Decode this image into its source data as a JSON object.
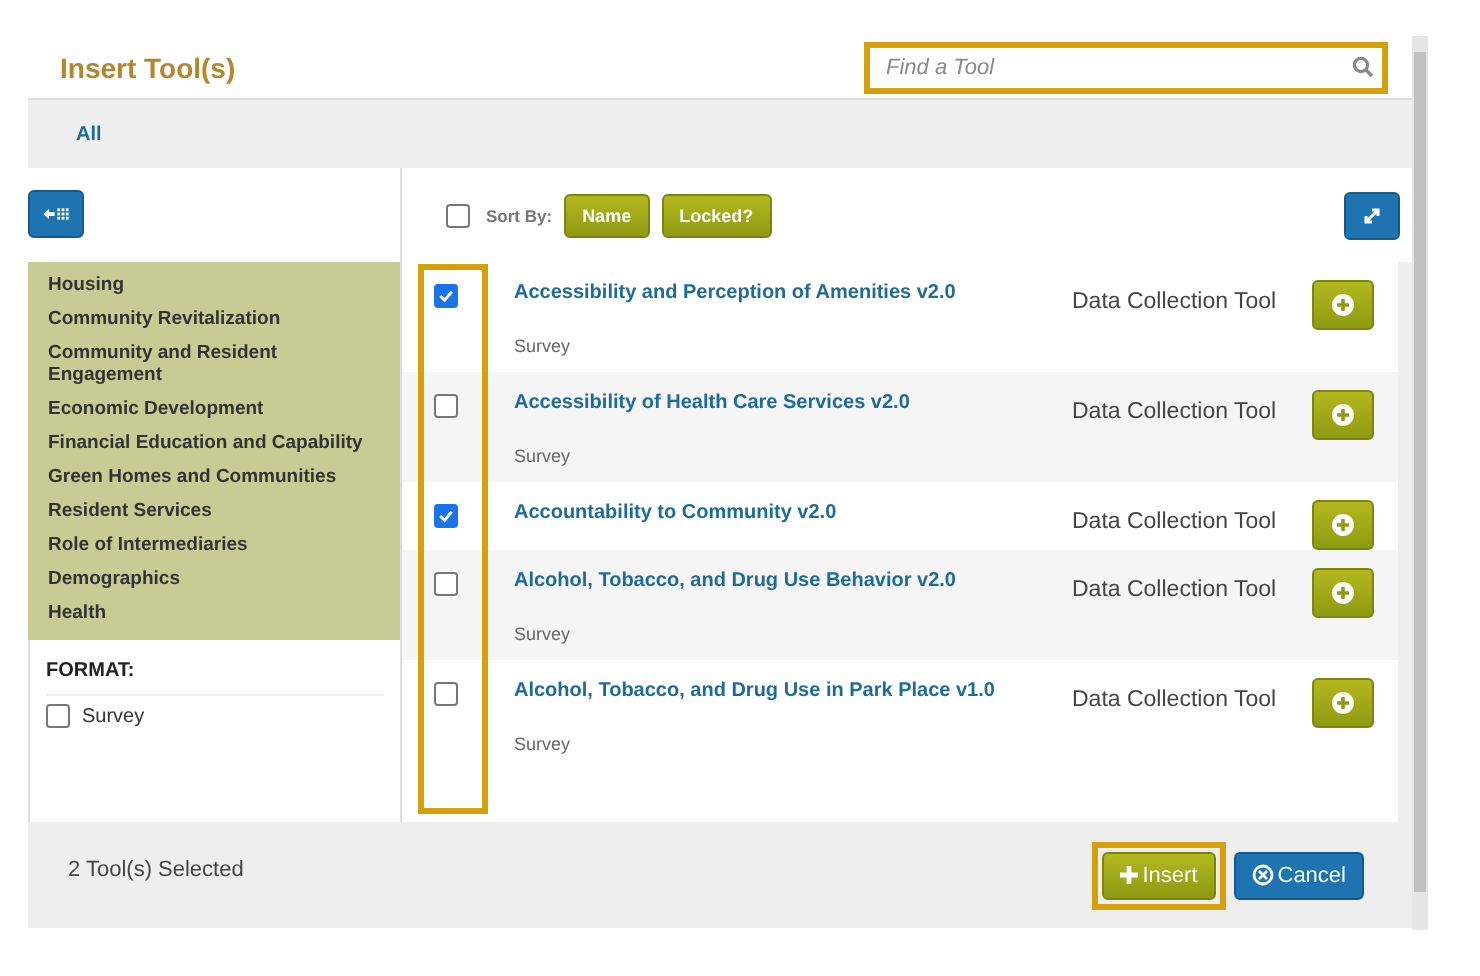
{
  "dialog": {
    "title": "Insert Tool(s)"
  },
  "search": {
    "placeholder": "Find a Tool",
    "highlighted": true
  },
  "tabs": [
    {
      "label": "All",
      "selected": true
    }
  ],
  "sort": {
    "select_all_checked": false,
    "label": "Sort By:",
    "buttons": [
      "Name",
      "Locked?"
    ]
  },
  "categories": [
    "Housing",
    "Community Revitalization",
    "Community and Resident Engagement",
    "Economic Development",
    "Financial Education and Capability",
    "Green Homes and Communities",
    "Resident Services",
    "Role of Intermediaries",
    "Demographics",
    "Health"
  ],
  "format": {
    "heading": "FORMAT:",
    "options": [
      {
        "label": "Survey",
        "checked": false
      }
    ]
  },
  "checkbox_column_highlighted": true,
  "tools": [
    {
      "name": "Accessibility and Perception of Amenities v2.0",
      "format": "Survey",
      "type": "Data Collection Tool",
      "checked": true
    },
    {
      "name": "Accessibility of Health Care Services v2.0",
      "format": "Survey",
      "type": "Data Collection Tool",
      "checked": false
    },
    {
      "name": "Accountability to Community v2.0",
      "type": "Data Collection Tool",
      "checked": true
    },
    {
      "name": "Alcohol, Tobacco, and Drug Use Behavior v2.0",
      "format": "Survey",
      "type": "Data Collection Tool",
      "checked": false
    },
    {
      "name": "Alcohol, Tobacco, and Drug Use in Park Place v1.0",
      "format": "Survey",
      "type": "Data Collection Tool",
      "checked": false
    }
  ],
  "footer": {
    "status": "2 Tool(s) Selected",
    "buttons": [
      {
        "kind": "insert",
        "label": "Insert",
        "highlighted": true
      },
      {
        "kind": "cancel",
        "label": "Cancel",
        "highlighted": false
      }
    ]
  }
}
